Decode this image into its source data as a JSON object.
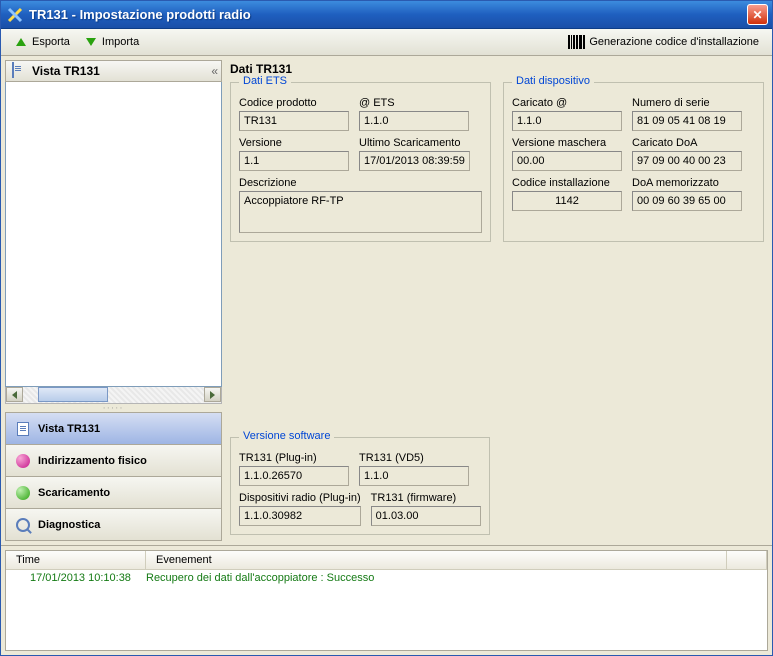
{
  "window": {
    "title": "TR131 - Impostazione prodotti radio"
  },
  "toolbar": {
    "export_label": "Esporta",
    "import_label": "Importa",
    "gen_code_label": "Generazione codice d'installazione"
  },
  "sidebar": {
    "header": "Vista TR131",
    "collapse_glyph": "«",
    "items": [
      {
        "label": "Vista TR131"
      },
      {
        "label": "Indirizzamento fisico"
      },
      {
        "label": "Scaricamento"
      },
      {
        "label": "Diagnostica"
      }
    ]
  },
  "main": {
    "title": "Dati TR131",
    "groups": {
      "ets": {
        "legend": "Dati ETS",
        "fields": {
          "codice_prodotto": {
            "label": "Codice prodotto",
            "value": "TR131"
          },
          "at_ets": {
            "label": "@ ETS",
            "value": "1.1.0"
          },
          "versione": {
            "label": "Versione",
            "value": "1.1"
          },
          "ultimo_scaric": {
            "label": "Ultimo Scaricamento",
            "value": "17/01/2013 08:39:59"
          },
          "descrizione": {
            "label": "Descrizione",
            "value": "Accoppiatore RF-TP"
          }
        }
      },
      "dispositivo": {
        "legend": "Dati dispositivo",
        "fields": {
          "caricato_at": {
            "label": "Caricato @",
            "value": "1.1.0"
          },
          "numero_serie": {
            "label": "Numero di serie",
            "value": "81 09 05 41 08 19"
          },
          "versione_maschera": {
            "label": "Versione maschera",
            "value": "00.00"
          },
          "caricato_doa": {
            "label": "Caricato DoA",
            "value": "97 09 00 40 00 23"
          },
          "codice_install": {
            "label": "Codice installazione",
            "value": "1142"
          },
          "doa_memorizzato": {
            "label": "DoA memorizzato",
            "value": "00 09 60 39 65 00"
          }
        }
      },
      "software": {
        "legend": "Versione software",
        "fields": {
          "tr131_plugin": {
            "label": "TR131 (Plug-in)",
            "value": "1.1.0.26570"
          },
          "tr131_vd5": {
            "label": "TR131 (VD5)",
            "value": "1.1.0"
          },
          "disp_radio": {
            "label": "Dispositivi radio (Plug-in)",
            "value": "1.1.0.30982"
          },
          "tr131_firmware": {
            "label": "TR131 (firmware)",
            "value": "01.03.00"
          }
        }
      }
    }
  },
  "log": {
    "headers": {
      "time": "Time",
      "event": "Evenement"
    },
    "rows": [
      {
        "time": "17/01/2013 10:10:38",
        "event": "Recupero dei dati dall'accoppiatore : Successo"
      }
    ]
  }
}
